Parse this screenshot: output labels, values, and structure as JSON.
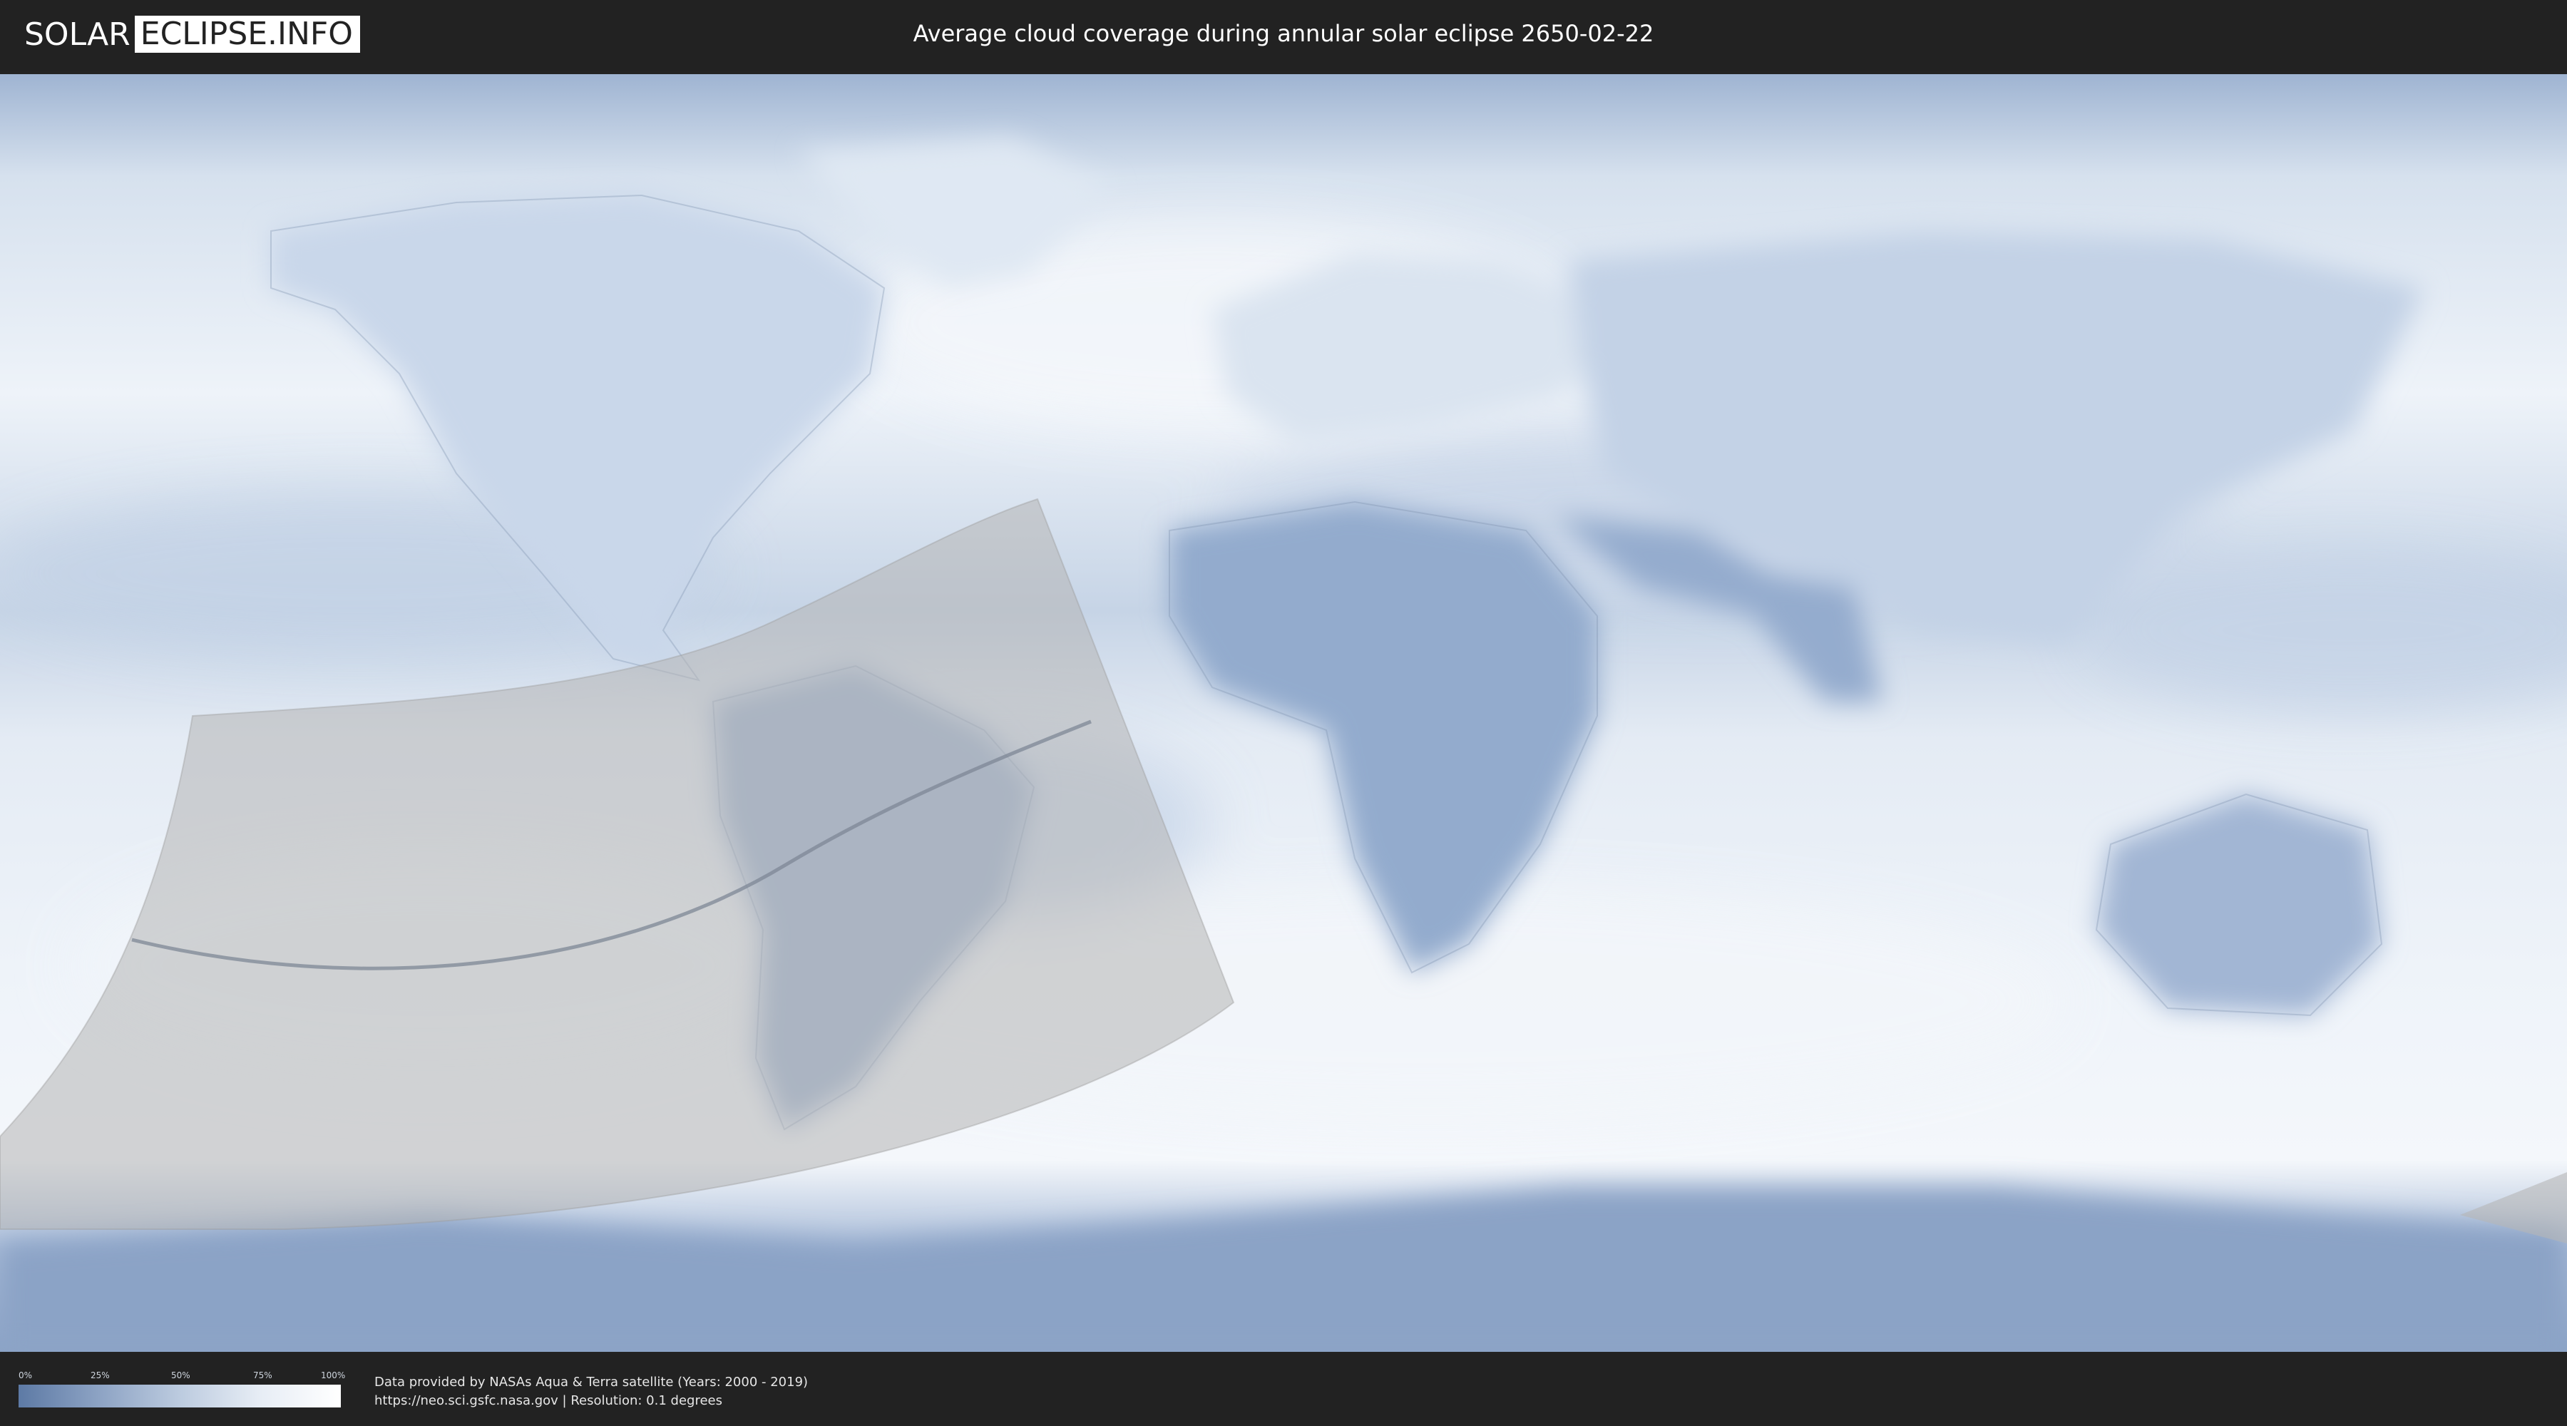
{
  "header": {
    "logo_left": "SOLAR",
    "logo_right": "ECLIPSE.INFO",
    "title": "Average cloud coverage during annular solar eclipse 2650-02-22"
  },
  "map": {
    "type": "cloud-coverage-world-map",
    "eclipse_date": "2650-02-22",
    "eclipse_type": "annular",
    "colors": {
      "ocean_cloud_light": "#e9eff7",
      "cloud_dense": "#5d7aa5",
      "eclipse_zone_overlay": "#b7b7b7",
      "central_path_line": "#7d8796"
    }
  },
  "legend": {
    "ticks": [
      "0%",
      "25%",
      "50%",
      "75%",
      "100%"
    ],
    "gradient_colors": [
      "#5d7aa5",
      "#8da3c4",
      "#bccbdf",
      "#e7edf5",
      "#ffffff"
    ]
  },
  "footer": {
    "credit_line1": "Data provided by NASAs Aqua & Terra satellite (Years: 2000 - 2019)",
    "credit_line2": "https://neo.sci.gsfc.nasa.gov | Resolution: 0.1 degrees"
  }
}
